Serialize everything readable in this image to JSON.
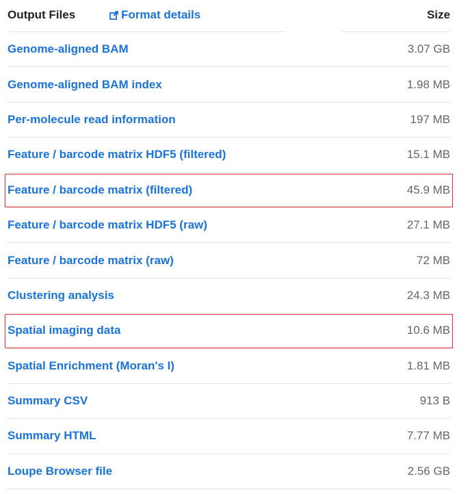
{
  "header": {
    "title": "Output Files",
    "format_link": "Format details",
    "size_label": "Size"
  },
  "files": [
    {
      "name": "Genome-aligned BAM",
      "size": "3.07 GB",
      "highlighted": false
    },
    {
      "name": "Genome-aligned BAM index",
      "size": "1.98 MB",
      "highlighted": false
    },
    {
      "name": "Per-molecule read information",
      "size": "197 MB",
      "highlighted": false
    },
    {
      "name": "Feature / barcode matrix HDF5 (filtered)",
      "size": "15.1 MB",
      "highlighted": false
    },
    {
      "name": "Feature / barcode matrix (filtered)",
      "size": "45.9 MB",
      "highlighted": true
    },
    {
      "name": "Feature / barcode matrix HDF5 (raw)",
      "size": "27.1 MB",
      "highlighted": false
    },
    {
      "name": "Feature / barcode matrix (raw)",
      "size": "72 MB",
      "highlighted": false
    },
    {
      "name": "Clustering analysis",
      "size": "24.3 MB",
      "highlighted": false
    },
    {
      "name": "Spatial imaging data",
      "size": "10.6 MB",
      "highlighted": true
    },
    {
      "name": "Spatial Enrichment (Moran's I)",
      "size": "1.81 MB",
      "highlighted": false
    },
    {
      "name": "Summary CSV",
      "size": "913 B",
      "highlighted": false
    },
    {
      "name": "Summary HTML",
      "size": "7.77 MB",
      "highlighted": false
    },
    {
      "name": "Loupe Browser file",
      "size": "2.56 GB",
      "highlighted": false
    }
  ],
  "colors": {
    "link": "#1a73d9",
    "text": "#222222",
    "muted": "#666666",
    "highlight_border": "#e03030"
  },
  "icons": {
    "format_link_icon": "external-link-icon"
  }
}
